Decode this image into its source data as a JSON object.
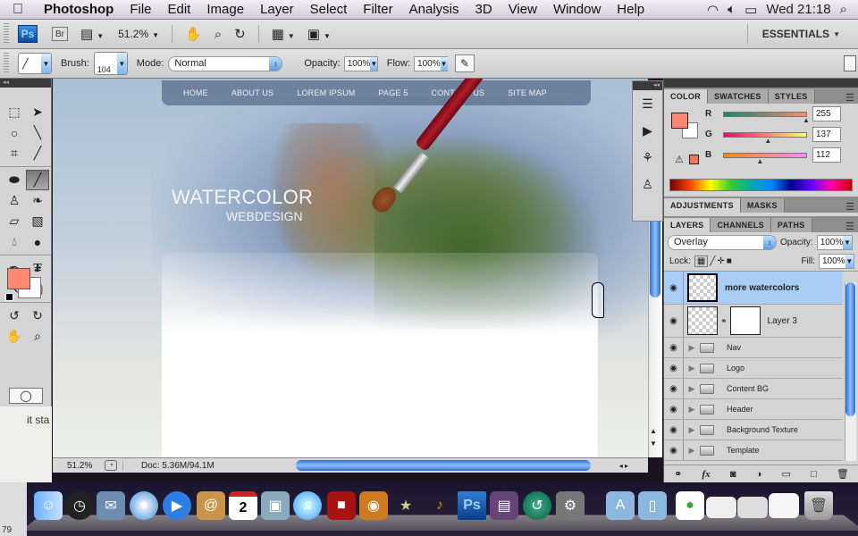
{
  "menubar": {
    "app_name": "Photoshop",
    "menus": [
      "File",
      "Edit",
      "Image",
      "Layer",
      "Select",
      "Filter",
      "Analysis",
      "3D",
      "View",
      "Window",
      "Help"
    ],
    "clock": "Wed 21:18",
    "icons": [
      "apple-icon",
      "wifi-icon",
      "volume-icon",
      "battery-icon",
      "spotlight-icon"
    ]
  },
  "appbar": {
    "ps_label": "Ps",
    "br_label": "Br",
    "zoom_value": "51.2%",
    "workspace": "ESSENTIALS"
  },
  "options": {
    "brush_label": "Brush:",
    "brush_size": "104",
    "mode_label": "Mode:",
    "mode_value": "Normal",
    "opacity_label": "Opacity:",
    "opacity_value": "100%",
    "flow_label": "Flow:",
    "flow_value": "100%"
  },
  "canvas": {
    "nav": [
      "HOME",
      "ABOUT US",
      "LOREM IPSUM",
      "PAGE 5",
      "CONTACT US",
      "SITE MAP"
    ],
    "logo_main": "WATERCOLOR",
    "logo_sub": "WEBDESIGN"
  },
  "colors": {
    "foreground": "#ff8970",
    "background": "#ffffff"
  },
  "status": {
    "zoom": "51.2%",
    "doc": "Doc: 5.36M/94.1M"
  },
  "color_panel": {
    "tabs": [
      "COLOR",
      "SWATCHES",
      "STYLES"
    ],
    "r_label": "R",
    "g_label": "G",
    "b_label": "B",
    "r": "255",
    "g": "137",
    "b": "112",
    "r_frac": 1.0,
    "g_frac": 0.537,
    "b_frac": 0.439
  },
  "adjust_panel": {
    "tabs": [
      "ADJUSTMENTS",
      "MASKS"
    ]
  },
  "layers_panel": {
    "tabs": [
      "LAYERS",
      "CHANNELS",
      "PATHS"
    ],
    "blend_mode": "Overlay",
    "opacity_label": "Opacity:",
    "opacity": "100%",
    "lock_label": "Lock:",
    "fill_label": "Fill:",
    "fill": "100%",
    "layers": [
      {
        "name": "more watercolors",
        "selected": true,
        "type": "layer"
      },
      {
        "name": "Layer 3",
        "selected": false,
        "type": "masked"
      },
      {
        "name": "Nav",
        "type": "group"
      },
      {
        "name": "Logo",
        "type": "group"
      },
      {
        "name": "Content BG",
        "type": "group"
      },
      {
        "name": "Header",
        "type": "group"
      },
      {
        "name": "Background Texture",
        "type": "group"
      },
      {
        "name": "Template",
        "type": "group"
      }
    ]
  },
  "side_window": {
    "text": "it sta",
    "text2": "79"
  },
  "dock": {
    "apps": [
      "Finder",
      "Dashboard",
      "Mail",
      "Safari",
      "iChat",
      "Address Book",
      "iCal",
      "iPhoto",
      "iTunes",
      "Photo Booth",
      "Image Capture",
      "iMovie",
      "GarageBand",
      "Photoshop",
      "Front Row",
      "Time Machine",
      "System Preferences"
    ],
    "ical_date": "2"
  }
}
